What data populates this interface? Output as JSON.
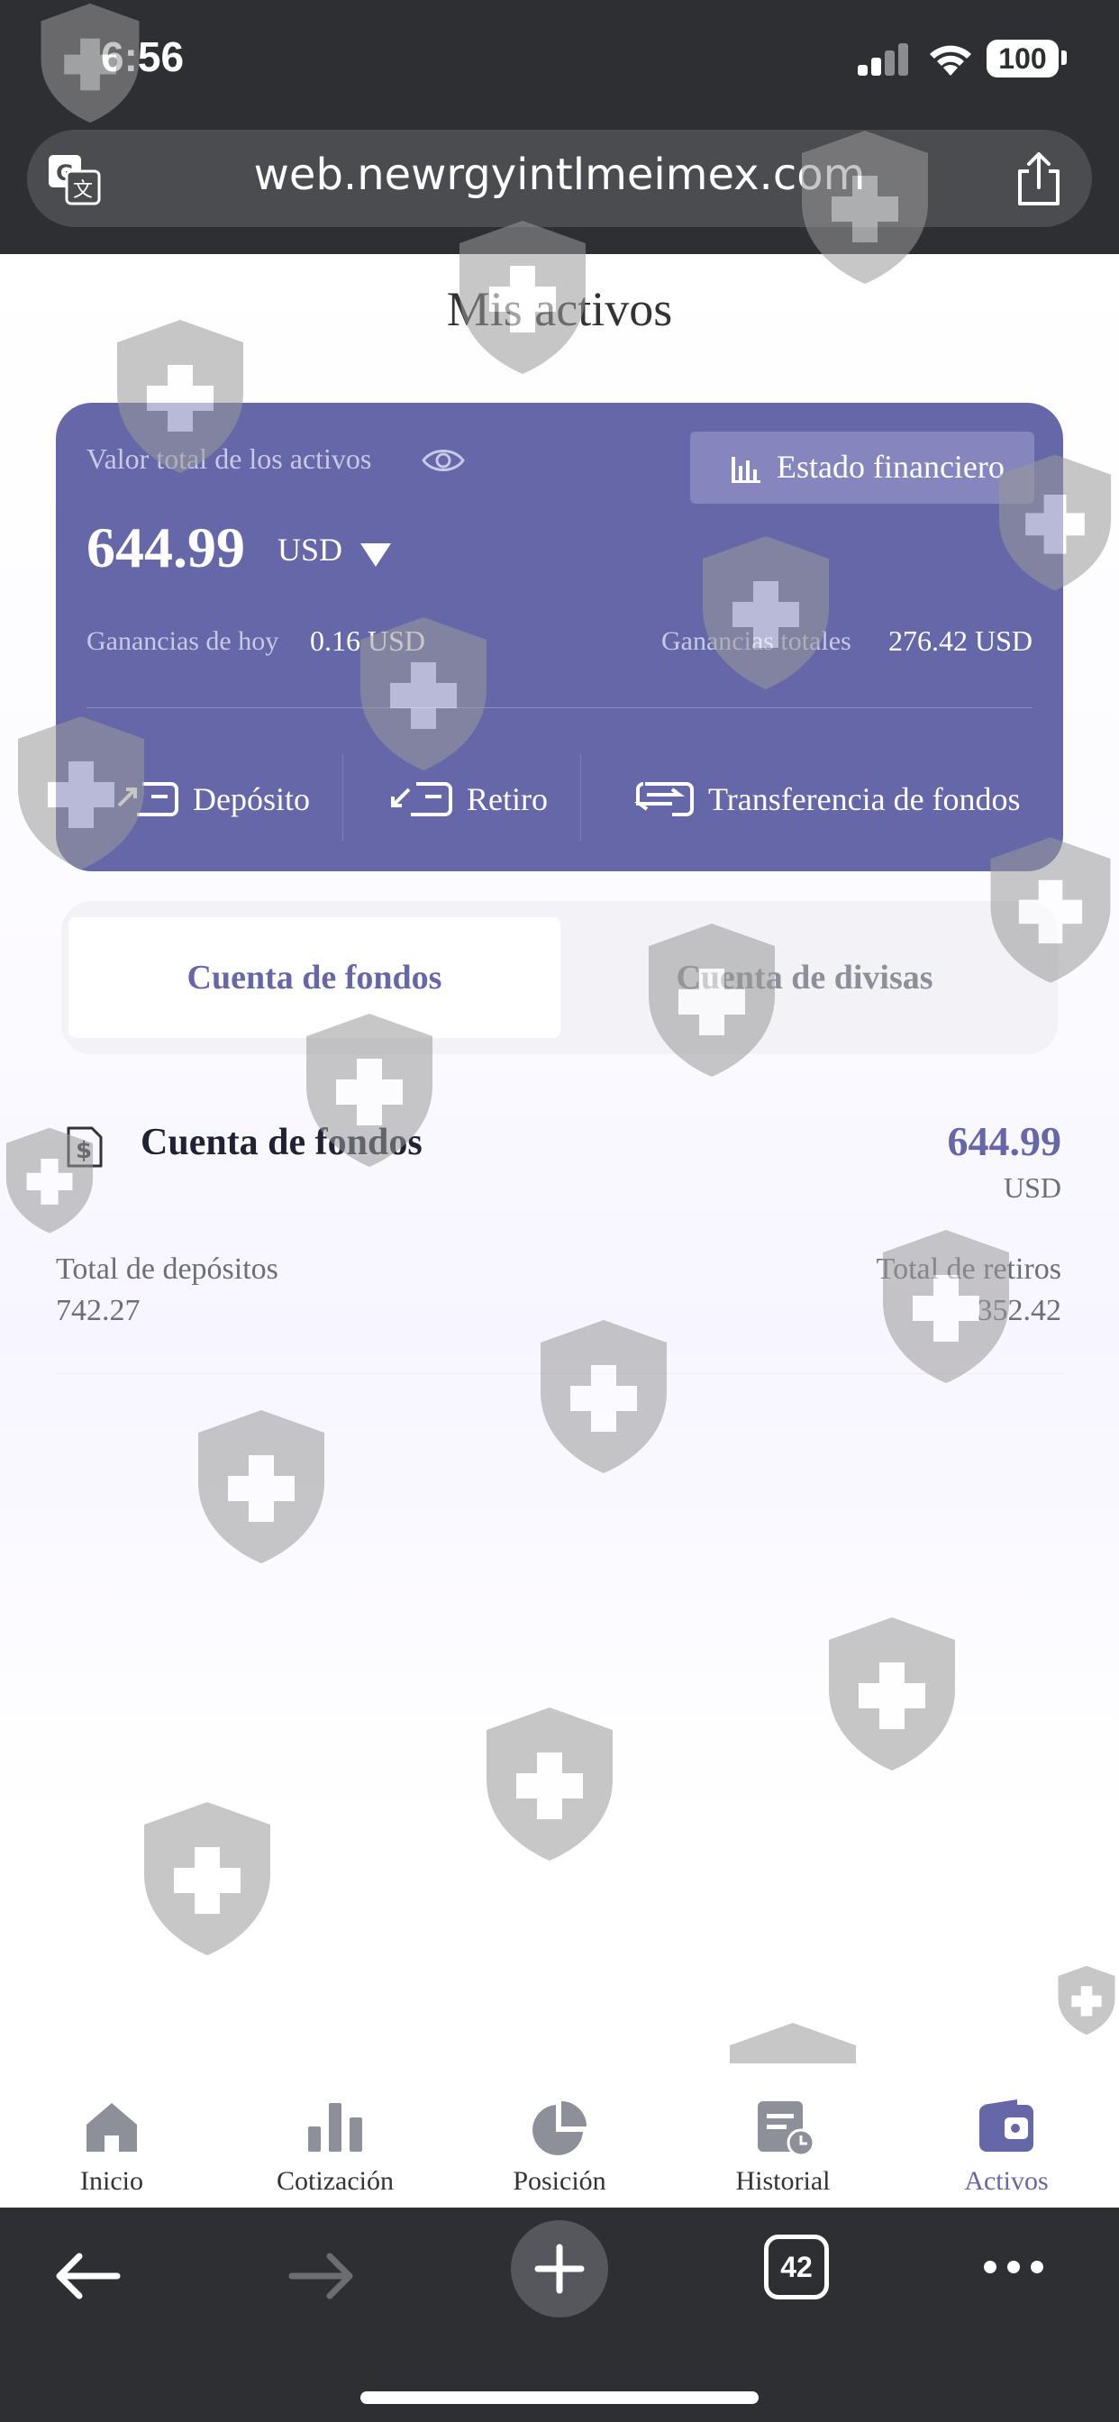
{
  "status_bar": {
    "time": "6:56",
    "battery": "100"
  },
  "browser": {
    "url": "web.newrgyintlmeimex.com",
    "tab_count": "42"
  },
  "page": {
    "title": "Mis activos"
  },
  "asset_card": {
    "total_label": "Valor total de los activos",
    "total_value": "644.99",
    "currency": "USD",
    "statement_button": "Estado financiero",
    "today_label": "Ganancias de hoy",
    "today_value": "0.16 USD",
    "overall_label": "Ganancias totales",
    "overall_value": "276.42 USD",
    "actions": [
      "Depósito",
      "Retiro",
      "Transferencia de fondos"
    ],
    "background_color": "#6567a8"
  },
  "tabs": [
    "Cuenta de fondos",
    "Cuenta de divisas"
  ],
  "fund_account": {
    "title": "Cuenta de fondos",
    "value": "644.99",
    "currency": "USD",
    "deposits_label": "Total de depósitos",
    "deposits_value": "742.27",
    "withdrawals_label": "Total de retiros",
    "withdrawals_value": "352.42"
  },
  "bottom_nav": [
    {
      "label": "Inicio",
      "icon": "home-icon"
    },
    {
      "label": "Cotización",
      "icon": "bar-chart-icon"
    },
    {
      "label": "Posición",
      "icon": "pie-chart-icon"
    },
    {
      "label": "Historial",
      "icon": "history-icon"
    },
    {
      "label": "Activos",
      "icon": "wallet-icon",
      "active": true
    }
  ],
  "accent_color": "#6567a8"
}
